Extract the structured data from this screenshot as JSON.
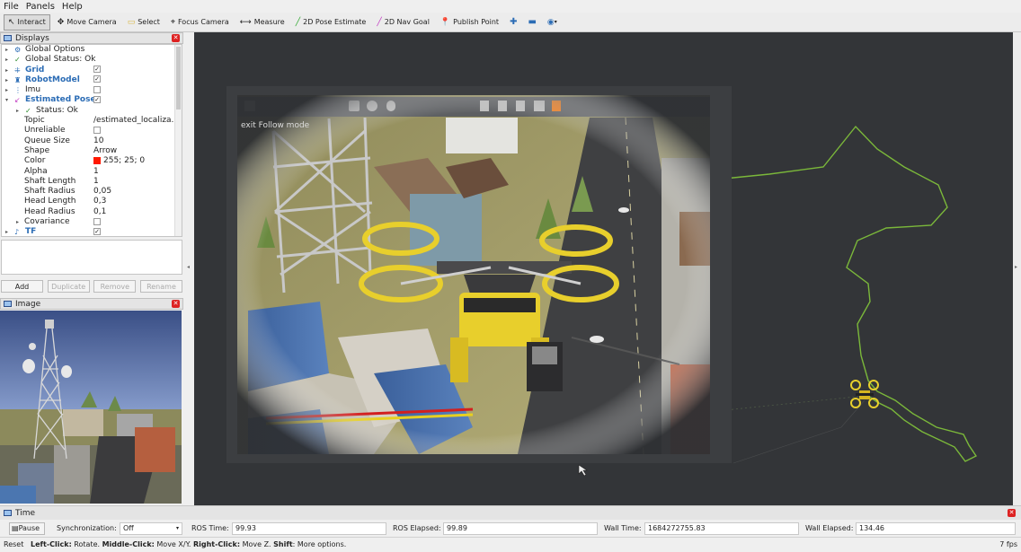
{
  "menu": [
    "File",
    "Panels",
    "Help"
  ],
  "toolbar": [
    {
      "label": "Interact",
      "icon": "cursor-icon",
      "active": true
    },
    {
      "label": "Move Camera",
      "icon": "move-camera-icon"
    },
    {
      "label": "Select",
      "icon": "select-icon"
    },
    {
      "label": "Focus Camera",
      "icon": "focus-camera-icon"
    },
    {
      "label": "Measure",
      "icon": "measure-icon"
    },
    {
      "label": "2D Pose Estimate",
      "icon": "pose-estimate-icon"
    },
    {
      "label": "2D Nav Goal",
      "icon": "nav-goal-icon"
    },
    {
      "label": "Publish Point",
      "icon": "publish-point-icon"
    }
  ],
  "displays": {
    "title": "Displays",
    "rows": [
      {
        "indent": 0,
        "arrow": "▸",
        "icon": "⚙",
        "label": "Global Options",
        "value": ""
      },
      {
        "indent": 0,
        "arrow": "▸",
        "icon": "✓",
        "label": "Global Status: Ok",
        "value": ""
      },
      {
        "indent": 0,
        "arrow": "▸",
        "icon": "⁜",
        "label": "Grid",
        "value": "",
        "bold": true,
        "checked": true
      },
      {
        "indent": 0,
        "arrow": "▸",
        "icon": "♜",
        "label": "RobotModel",
        "value": "",
        "bold": true,
        "checked": true
      },
      {
        "indent": 0,
        "arrow": "▸",
        "icon": "⋮",
        "label": "Imu",
        "value": "",
        "checked": false
      },
      {
        "indent": 0,
        "arrow": "▾",
        "icon": "↙",
        "label": "Estimated Pose",
        "value": "",
        "bold": true,
        "checked": true
      },
      {
        "indent": 1,
        "arrow": "▸",
        "icon": "✓",
        "label": "Status: Ok",
        "value": ""
      },
      {
        "indent": 2,
        "label": "Topic",
        "value": "/estimated_localiza..."
      },
      {
        "indent": 2,
        "label": "Unreliable",
        "value": "",
        "checked": false
      },
      {
        "indent": 2,
        "label": "Queue Size",
        "value": "10"
      },
      {
        "indent": 2,
        "label": "Shape",
        "value": "Arrow"
      },
      {
        "indent": 2,
        "label": "Color",
        "value": "255; 25; 0",
        "swatch": "#ff1900"
      },
      {
        "indent": 2,
        "label": "Alpha",
        "value": "1"
      },
      {
        "indent": 2,
        "label": "Shaft Length",
        "value": "1"
      },
      {
        "indent": 2,
        "label": "Shaft Radius",
        "value": "0,05"
      },
      {
        "indent": 2,
        "label": "Head Length",
        "value": "0,3"
      },
      {
        "indent": 2,
        "label": "Head Radius",
        "value": "0,1"
      },
      {
        "indent": 2,
        "arrow": "▸",
        "label": "Covariance",
        "value": "",
        "checked": false
      },
      {
        "indent": 0,
        "arrow": "▸",
        "icon": "♪",
        "label": "TF",
        "value": "",
        "bold": true,
        "checked": true
      }
    ]
  },
  "buttons": {
    "add": "Add",
    "duplicate": "Duplicate",
    "remove": "Remove",
    "rename": "Rename"
  },
  "image_panel": {
    "title": "Image"
  },
  "overlay": {
    "hint": "exit Follow mode"
  },
  "time": {
    "title": "Time",
    "pause": "Pause",
    "sync_label": "Synchronization:",
    "sync_value": "Off",
    "ros_time_label": "ROS Time:",
    "ros_time": "99.93",
    "ros_elapsed_label": "ROS Elapsed:",
    "ros_elapsed": "99.89",
    "wall_time_label": "Wall Time:",
    "wall_time": "1684272755.83",
    "wall_elapsed_label": "Wall Elapsed:",
    "wall_elapsed": "134.46"
  },
  "status": {
    "reset": "Reset",
    "hint_parts": [
      {
        "t": "Left-Click:",
        "b": true
      },
      {
        "t": " Rotate. ",
        "b": false
      },
      {
        "t": "Middle-Click:",
        "b": true
      },
      {
        "t": " Move X/Y. ",
        "b": false
      },
      {
        "t": "Right-Click:",
        "b": true
      },
      {
        "t": " Move Z. ",
        "b": false
      },
      {
        "t": "Shift",
        "b": true
      },
      {
        "t": ": More options.",
        "b": false
      }
    ],
    "fps": "7 fps"
  },
  "colors": {
    "path": "#7bb83a",
    "drone": "#e8cf2c",
    "accent_blue": "#2b6cb5",
    "close": "#d22222"
  }
}
